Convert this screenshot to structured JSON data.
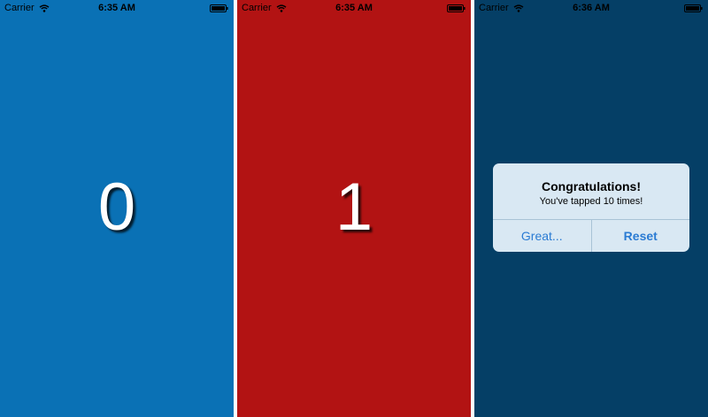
{
  "screens": [
    {
      "status": {
        "carrier": "Carrier",
        "time": "6:35 AM"
      },
      "background": "#0a71b5",
      "count": "0"
    },
    {
      "status": {
        "carrier": "Carrier",
        "time": "6:35 AM"
      },
      "background": "#b21313",
      "count": "1"
    },
    {
      "status": {
        "carrier": "Carrier",
        "time": "6:36 AM"
      },
      "background": "#053f66",
      "alert": {
        "title": "Congratulations!",
        "message": "You've tapped 10 times!",
        "buttons": [
          "Great...",
          "Reset"
        ]
      }
    }
  ],
  "icons": {
    "wifi": "wifi-icon",
    "battery": "battery-icon"
  },
  "colors": {
    "alert_button_text": "#2a7bd3",
    "alert_background": "#d9e8f3"
  }
}
